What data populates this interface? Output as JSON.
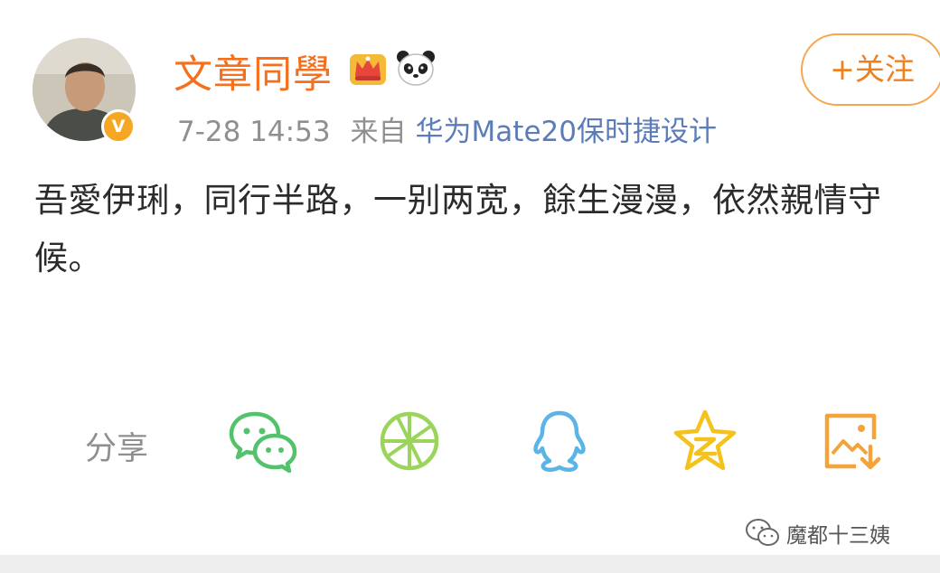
{
  "header": {
    "username": "文章同學",
    "verified_badge": "V",
    "timestamp": "7-28 14:53",
    "source_prefix": "来自",
    "source_device": "华为Mate20保时捷设计",
    "follow_label": "+关注"
  },
  "post": {
    "text": "吾愛伊琍，同行半路，一别两宽，餘生漫漫，依然親情守候。"
  },
  "share": {
    "label": "分享",
    "targets": [
      "wechat-icon",
      "moments-icon",
      "qq-icon",
      "qzone-icon",
      "save-image-icon"
    ]
  },
  "watermark": {
    "text": "魔都十三姨"
  },
  "colors": {
    "username": "#f56f1c",
    "link": "#5a7db9",
    "meta": "#8f8f8f",
    "wechat": "#52c26b",
    "moments": "#9bd45a",
    "qq": "#5ab4e8",
    "qzone": "#f5c21b",
    "save": "#f3a338"
  }
}
